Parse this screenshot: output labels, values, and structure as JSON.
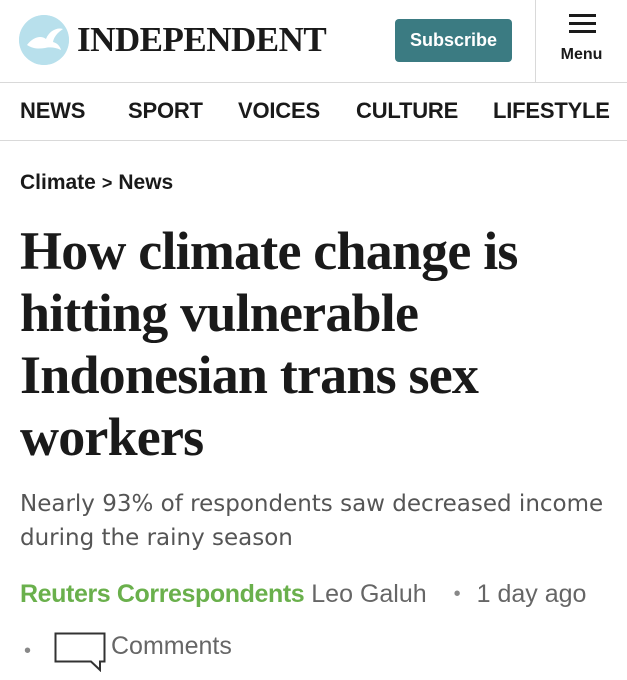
{
  "header": {
    "logo_alt": "Independent eagle logo",
    "wordmark": "INDEPENDENT",
    "subscribe_label": "Subscribe",
    "menu_label": "Menu"
  },
  "nav": {
    "items": [
      {
        "label": "NEWS"
      },
      {
        "label": "SPORT"
      },
      {
        "label": "VOICES"
      },
      {
        "label": "CULTURE"
      },
      {
        "label": "LIFESTYLE"
      }
    ]
  },
  "breadcrumb": {
    "items": [
      {
        "label": "Climate"
      },
      {
        "label": "News"
      }
    ],
    "separator": ">"
  },
  "article": {
    "headline": "How climate change is hitting vulnerable Indonesian trans sex workers",
    "standfirst": "Nearly 93% of respondents saw decreased income during the rainy season",
    "byline": {
      "agency": "Reuters Correspondents",
      "author": "Leo Galuh",
      "dot": "•",
      "time": "1 day ago"
    },
    "comments_label": "Comments"
  },
  "colors": {
    "subscribe_bg": "#3b7b82",
    "agency_green": "#6ab04c",
    "logo_circle": "#b8e0ec",
    "text_dark": "#1a1a1a",
    "text_grey": "#555555"
  },
  "icons": {
    "logo": "eagle-icon",
    "menu": "hamburger-menu-icon",
    "comments": "speech-bubble-icon"
  }
}
